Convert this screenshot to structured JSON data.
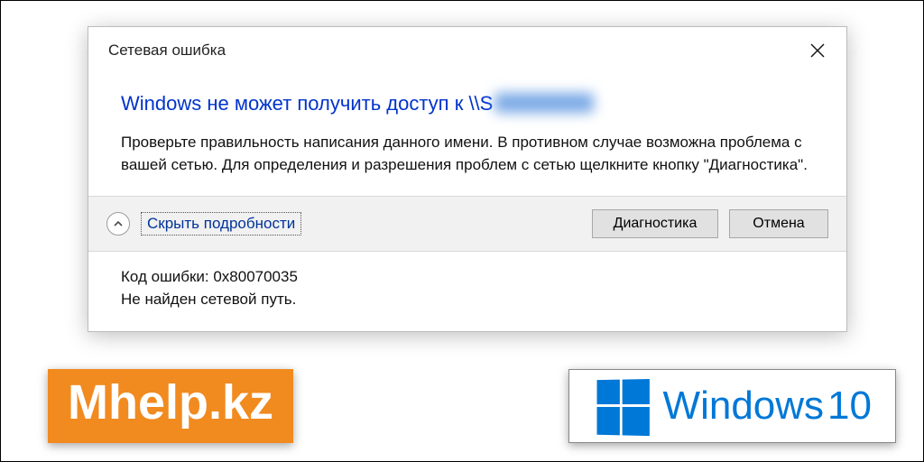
{
  "dialog": {
    "title": "Сетевая ошибка",
    "headline_prefix": "Windows не может получить доступ к \\\\S",
    "body": "Проверьте правильность написания данного имени. В противном случае возможна проблема с вашей сетью. Для определения и разрешения проблем с сетью щелкните кнопку \"Диагностика\".",
    "toggle_label": "Скрыть подробности",
    "diagnose_label": "Диагностика",
    "cancel_label": "Отмена",
    "details_code": "Код ошибки: 0x80070035",
    "details_msg": "Не найден сетевой путь."
  },
  "badges": {
    "mhelp": "Mhelp.kz",
    "windows": "Windows",
    "ten": "10"
  }
}
